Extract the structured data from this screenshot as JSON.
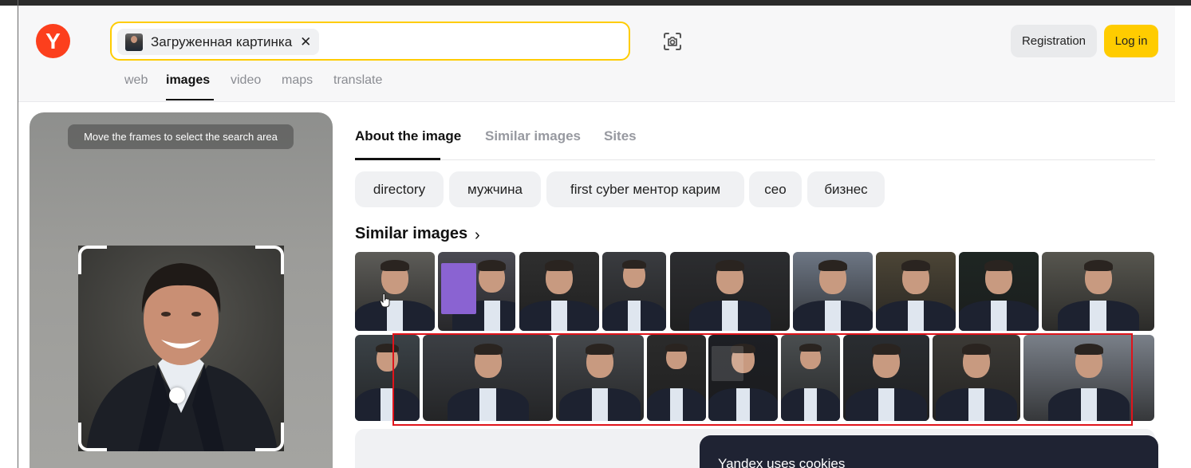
{
  "header": {
    "logo_letter": "Y",
    "search_chip_label": "Загруженная картинка",
    "search_chip_close": "✕",
    "registration_label": "Registration",
    "login_label": "Log in"
  },
  "nav": {
    "items": [
      "web",
      "images",
      "video",
      "maps",
      "translate"
    ],
    "active": "images"
  },
  "left_panel": {
    "hint": "Move the frames to select the search area"
  },
  "tabs": {
    "items": [
      "About the image",
      "Similar images",
      "Sites"
    ],
    "active": "About the image"
  },
  "tags": [
    "directory",
    "мужчина",
    "first cyber ментор карим",
    "сео",
    "бизнес"
  ],
  "similar": {
    "title": "Similar images",
    "chevron": "›"
  },
  "cookie": {
    "text": "Yandex uses cookies"
  },
  "colors": {
    "brand_red": "#fc3f1d",
    "accent_yellow": "#ffcc00",
    "highlight_red": "#e0141b",
    "cookie_bg": "#1f2333"
  }
}
